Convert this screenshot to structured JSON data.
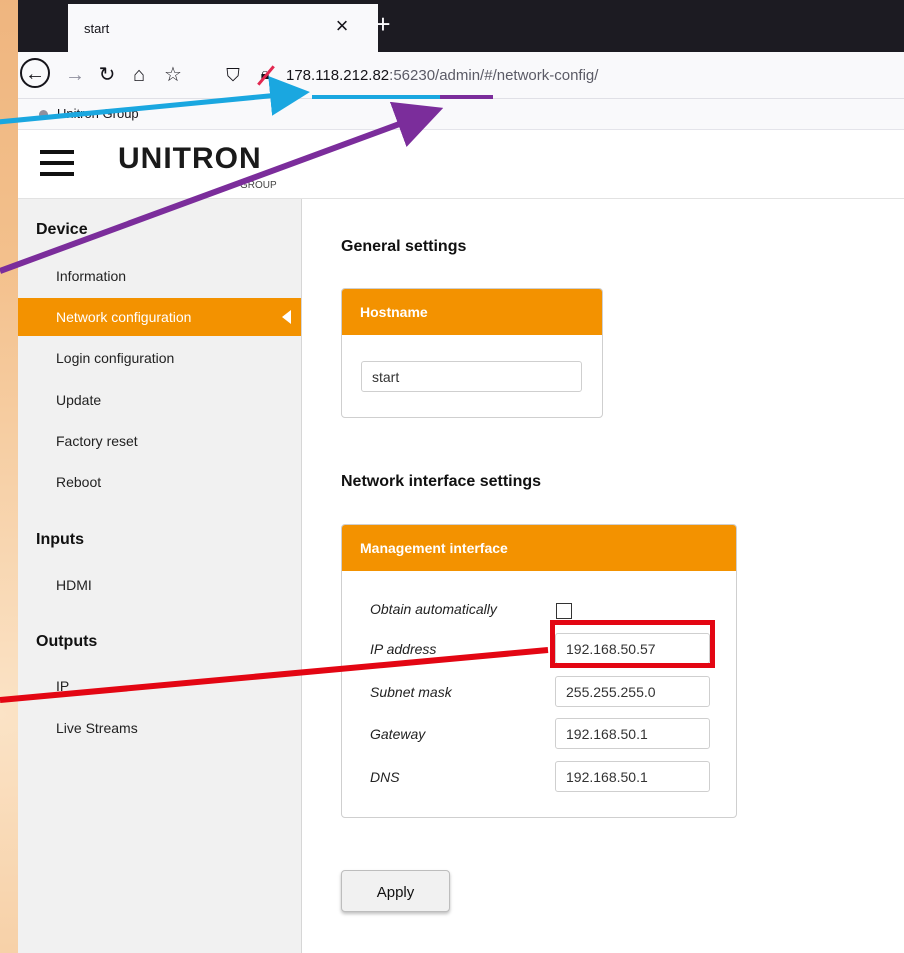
{
  "browser": {
    "tab_title": "start",
    "tab_close_glyph": "×",
    "new_tab_glyph": "+",
    "url_host": "178.118.212.82",
    "url_port_path": ":56230/admin/#/network-config/",
    "bookmark_label": "Unitron Group"
  },
  "header": {
    "logo_text": "UNITRON",
    "logo_sub": "GROUP"
  },
  "sidebar": {
    "sections": [
      {
        "title": "Device",
        "items": [
          "Information",
          "Network configuration",
          "Login configuration",
          "Update",
          "Factory reset",
          "Reboot"
        ]
      },
      {
        "title": "Inputs",
        "items": [
          "HDMI"
        ]
      },
      {
        "title": "Outputs",
        "items": [
          "IP",
          "Live Streams"
        ]
      }
    ],
    "active_item": "Network configuration"
  },
  "main": {
    "general_heading": "General settings",
    "hostname_panel_title": "Hostname",
    "hostname_value": "start",
    "network_heading": "Network interface settings",
    "mgmt_panel_title": "Management interface",
    "obtain_label": "Obtain automatically",
    "obtain_checked": false,
    "ip_label": "IP address",
    "ip_value": "192.168.50.57",
    "subnet_label": "Subnet mask",
    "subnet_value": "255.255.255.0",
    "gateway_label": "Gateway",
    "gateway_value": "192.168.50.1",
    "dns_label": "DNS",
    "dns_value": "192.168.50.1",
    "apply_label": "Apply"
  },
  "colors": {
    "accent": "#f39200",
    "highlight": "#e30613",
    "arrow_blue": "#1aa7e0",
    "arrow_purple": "#7b2d9b"
  }
}
